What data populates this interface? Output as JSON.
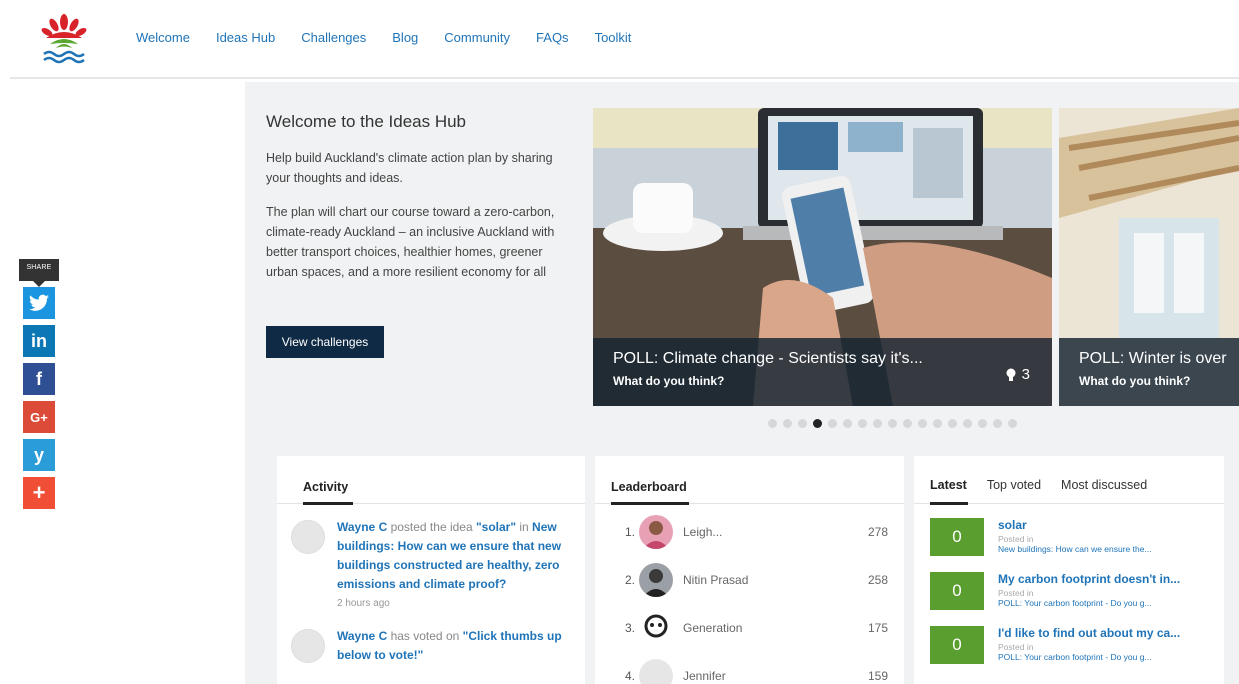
{
  "nav": {
    "items": [
      "Welcome",
      "Ideas Hub",
      "Challenges",
      "Blog",
      "Community",
      "FAQs",
      "Toolkit"
    ]
  },
  "share": {
    "label": "SHARE",
    "buttons": [
      {
        "icon": "twitter-icon",
        "glyph": "🐦",
        "color": "#1b95e0"
      },
      {
        "icon": "linkedin-icon",
        "glyph": "in",
        "color": "#0b78b5"
      },
      {
        "icon": "facebook-icon",
        "glyph": "f",
        "color": "#2f4f95"
      },
      {
        "icon": "google-plus-icon",
        "glyph": "G+",
        "color": "#dc4a38"
      },
      {
        "icon": "yammer-icon",
        "glyph": "y",
        "color": "#2a9dd8"
      },
      {
        "icon": "more-icon",
        "glyph": "+",
        "color": "#f04e35"
      }
    ]
  },
  "intro": {
    "title": "Welcome to the Ideas Hub",
    "para1": "Help build Auckland's climate action plan by sharing your thoughts and ideas.",
    "para2": "The plan will chart our course toward a zero-carbon, climate-ready Auckland – an inclusive Auckland with better transport choices, healthier homes, greener urban spaces, and a more resilient economy for all",
    "button": "View challenges"
  },
  "carousel": {
    "slides": [
      {
        "title": "POLL: Climate change - Scientists say it's...",
        "subtitle": "What do you think?",
        "count": "3"
      },
      {
        "title": "POLL: Winter is over",
        "subtitle": "What do you think?"
      }
    ],
    "dot_count": 17,
    "active_dot": 3
  },
  "activity": {
    "heading": "Activity",
    "items": [
      {
        "user": "Wayne C",
        "action": " posted the idea ",
        "target": "\"solar\"",
        "joiner": " in ",
        "context": "New buildings: How can we ensure that new buildings constructed are healthy, zero emissions and climate proof?",
        "time": "2 hours ago"
      },
      {
        "user": "Wayne C",
        "action": " has voted on ",
        "target": "\"Click thumbs up below to vote!\"",
        "joiner": "",
        "context": "",
        "time": ""
      }
    ]
  },
  "leaderboard": {
    "heading": "Leaderboard",
    "rows": [
      {
        "rank": "1.",
        "name": "Leigh...",
        "score": "278"
      },
      {
        "rank": "2.",
        "name": "Nitin Prasad",
        "score": "258"
      },
      {
        "rank": "3.",
        "name": "Generation",
        "score": "175"
      },
      {
        "rank": "4.",
        "name": "Jennifer",
        "score": "159"
      }
    ]
  },
  "latest": {
    "tabs": [
      "Latest",
      "Top voted",
      "Most discussed"
    ],
    "items": [
      {
        "votes": "0",
        "title": "solar",
        "posted": "Posted in",
        "category": "New buildings: How can we ensure the..."
      },
      {
        "votes": "0",
        "title": "My carbon footprint doesn't in...",
        "posted": "Posted in",
        "category": "POLL: Your carbon footprint - Do you g..."
      },
      {
        "votes": "0",
        "title": "I'd like to find out about my ca...",
        "posted": "Posted in",
        "category": "POLL: Your carbon footprint - Do you g..."
      }
    ]
  },
  "colors": {
    "nav_link": "#1f74b8",
    "button_dark": "#0f2a44",
    "vote_green": "#5a9e2f"
  }
}
